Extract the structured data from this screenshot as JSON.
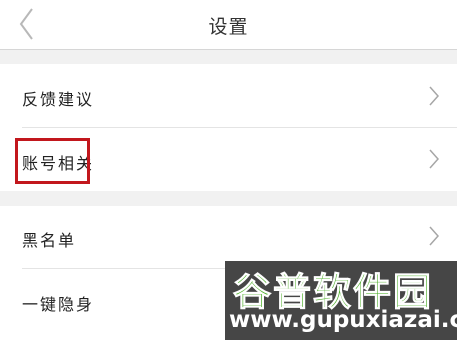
{
  "header": {
    "title": "设置",
    "back_icon": "chevron-left-icon"
  },
  "groups": [
    {
      "items": [
        {
          "label": "反馈建议",
          "icon": "chevron-right-icon"
        },
        {
          "label": "账号相关",
          "icon": "chevron-right-icon",
          "highlighted": true
        }
      ]
    },
    {
      "items": [
        {
          "label": "黑名单",
          "icon": "chevron-right-icon"
        },
        {
          "label": "一键隐身",
          "icon": "chevron-right-icon"
        }
      ]
    }
  ],
  "watermark": {
    "logo_text": "谷普软件园",
    "url": "www.gupuxiazai.com"
  },
  "colors": {
    "background": "#f1f1f1",
    "highlight": "#c2171d",
    "watermark_green": "#54b230",
    "watermark_bg": "#464646"
  }
}
